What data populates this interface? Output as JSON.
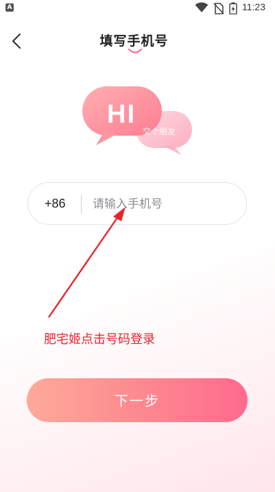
{
  "status_bar": {
    "notification_letter": "A",
    "time": "11:23",
    "icons": [
      "wifi-icon",
      "no-sim-icon",
      "battery-charging-icon"
    ]
  },
  "header": {
    "title": "填写手机号",
    "back_icon": "chevron-left-icon"
  },
  "illustration": {
    "hi_text": "HI",
    "friend_text": "交个朋友",
    "bubble_colors": [
      "#fd8f9c",
      "#fcb6c5"
    ]
  },
  "phone_form": {
    "country_code": "+86",
    "placeholder": "请输入手机号",
    "value": ""
  },
  "annotation": {
    "text": "肥宅姬点击号码登录",
    "color": "#e8242b"
  },
  "next_button": {
    "label": "下一步"
  },
  "colors": {
    "accent_start": "#fea99a",
    "accent_end": "#ff6a8e"
  }
}
